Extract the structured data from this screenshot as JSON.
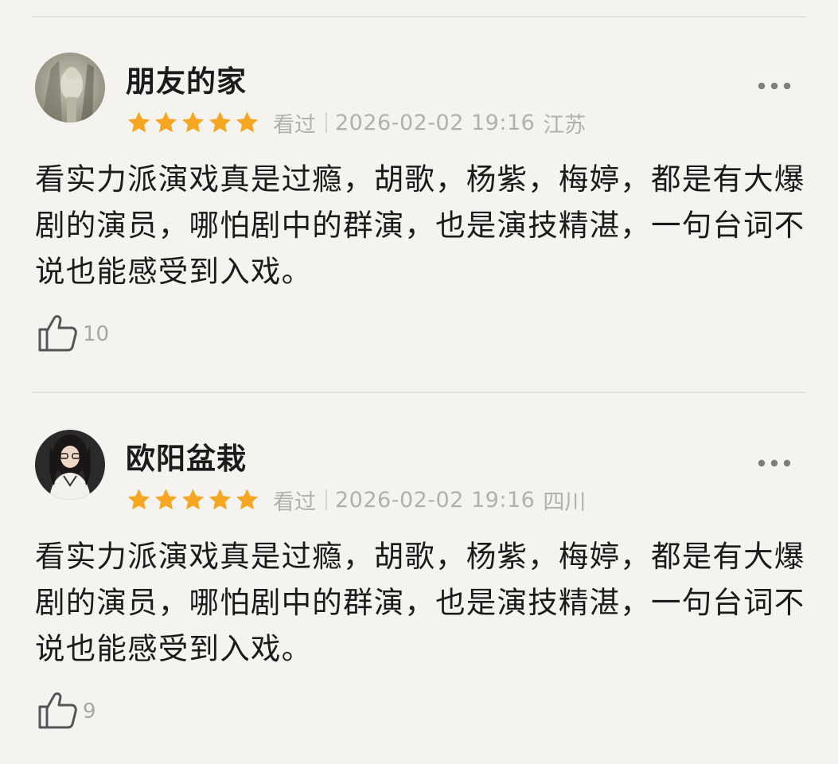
{
  "comments": [
    {
      "username": "朋友的家",
      "rating": 5,
      "status": "看过",
      "datetime": "2026-02-02 19:16",
      "location": "江苏",
      "text": "看实力派演戏真是过瘾，胡歌，杨紫，梅婷，都是有大爆剧的演员，哪怕剧中的群演，也是演技精湛，一句台词不说也能感受到入戏。",
      "likes": "10"
    },
    {
      "username": "欧阳盆栽",
      "rating": 5,
      "status": "看过",
      "datetime": "2026-02-02 19:16",
      "location": "四川",
      "text": "看实力派演戏真是过瘾，胡歌，杨紫，梅婷，都是有大爆剧的演员，哪怕剧中的群演，也是演技精湛，一句台词不说也能感受到入戏。",
      "likes": "9"
    }
  ],
  "colors": {
    "star": "#f5a623",
    "meta": "#b0b0ad",
    "background": "#f4f3ef"
  },
  "icons": {
    "more": "more-dots-icon",
    "like": "thumbs-up-icon",
    "star": "star-icon"
  }
}
